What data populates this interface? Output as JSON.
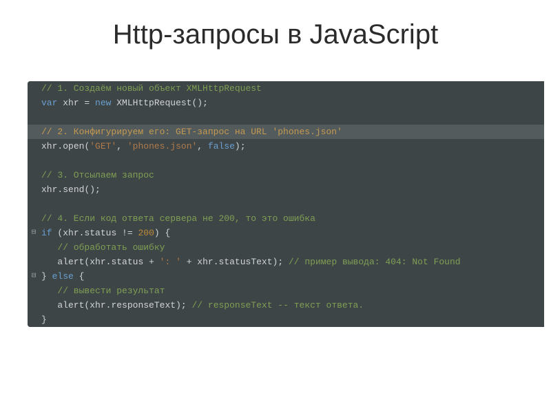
{
  "title": "Http-запросы в JavaScript",
  "code": {
    "lines": [
      {
        "gutter": "",
        "hl": false,
        "tokens": [
          {
            "cls": "c",
            "t": "// 1. Создаём новый объект XMLHttpRequest"
          }
        ]
      },
      {
        "gutter": "",
        "hl": false,
        "tokens": [
          {
            "cls": "kw",
            "t": "var"
          },
          {
            "cls": "pn",
            "t": " "
          },
          {
            "cls": "id",
            "t": "xhr"
          },
          {
            "cls": "pn",
            "t": " = "
          },
          {
            "cls": "kw",
            "t": "new"
          },
          {
            "cls": "pn",
            "t": " "
          },
          {
            "cls": "fn",
            "t": "XMLHttpRequest"
          },
          {
            "cls": "pn",
            "t": "();"
          }
        ]
      },
      {
        "gutter": "",
        "hl": false,
        "tokens": [
          {
            "cls": "pn",
            "t": " "
          }
        ]
      },
      {
        "gutter": "",
        "hl": true,
        "tokens": [
          {
            "cls": "c2",
            "t": "// 2. Конфигурируем его: GET-запрос на URL 'phones.json'"
          }
        ]
      },
      {
        "gutter": "",
        "hl": false,
        "tokens": [
          {
            "cls": "id",
            "t": "xhr"
          },
          {
            "cls": "pn",
            "t": "."
          },
          {
            "cls": "fn",
            "t": "open"
          },
          {
            "cls": "pn",
            "t": "("
          },
          {
            "cls": "st",
            "t": "'GET'"
          },
          {
            "cls": "pn",
            "t": ", "
          },
          {
            "cls": "st",
            "t": "'phones.json'"
          },
          {
            "cls": "pn",
            "t": ", "
          },
          {
            "cls": "kw2",
            "t": "false"
          },
          {
            "cls": "pn",
            "t": ");"
          }
        ]
      },
      {
        "gutter": "",
        "hl": false,
        "tokens": [
          {
            "cls": "pn",
            "t": " "
          }
        ]
      },
      {
        "gutter": "",
        "hl": false,
        "tokens": [
          {
            "cls": "c",
            "t": "// 3. Отсылаем запрос"
          }
        ]
      },
      {
        "gutter": "",
        "hl": false,
        "tokens": [
          {
            "cls": "id",
            "t": "xhr"
          },
          {
            "cls": "pn",
            "t": "."
          },
          {
            "cls": "fn",
            "t": "send"
          },
          {
            "cls": "pn",
            "t": "();"
          }
        ]
      },
      {
        "gutter": "",
        "hl": false,
        "tokens": [
          {
            "cls": "pn",
            "t": " "
          }
        ]
      },
      {
        "gutter": "",
        "hl": false,
        "tokens": [
          {
            "cls": "c",
            "t": "// 4. Если код ответа сервера не 200, то это ошибка"
          }
        ]
      },
      {
        "gutter": "⊟",
        "hl": false,
        "tokens": [
          {
            "cls": "kw",
            "t": "if"
          },
          {
            "cls": "pn",
            "t": " ("
          },
          {
            "cls": "id",
            "t": "xhr"
          },
          {
            "cls": "pn",
            "t": "."
          },
          {
            "cls": "id",
            "t": "status"
          },
          {
            "cls": "pn",
            "t": " != "
          },
          {
            "cls": "nm",
            "t": "200"
          },
          {
            "cls": "pn",
            "t": ") {"
          }
        ]
      },
      {
        "gutter": "",
        "hl": false,
        "tokens": [
          {
            "cls": "pn",
            "t": "   "
          },
          {
            "cls": "c",
            "t": "// обработать ошибку"
          }
        ]
      },
      {
        "gutter": "",
        "hl": false,
        "tokens": [
          {
            "cls": "pn",
            "t": "   "
          },
          {
            "cls": "fn",
            "t": "alert"
          },
          {
            "cls": "pn",
            "t": "("
          },
          {
            "cls": "id",
            "t": "xhr"
          },
          {
            "cls": "pn",
            "t": "."
          },
          {
            "cls": "id",
            "t": "status"
          },
          {
            "cls": "pn",
            "t": " + "
          },
          {
            "cls": "st",
            "t": "': '"
          },
          {
            "cls": "pn",
            "t": " + "
          },
          {
            "cls": "id",
            "t": "xhr"
          },
          {
            "cls": "pn",
            "t": "."
          },
          {
            "cls": "id",
            "t": "statusText"
          },
          {
            "cls": "pn",
            "t": "); "
          },
          {
            "cls": "c",
            "t": "// пример вывода: 404: Not Found"
          }
        ]
      },
      {
        "gutter": "⊟",
        "hl": false,
        "tokens": [
          {
            "cls": "pn",
            "t": "} "
          },
          {
            "cls": "kw",
            "t": "else"
          },
          {
            "cls": "pn",
            "t": " {"
          }
        ]
      },
      {
        "gutter": "",
        "hl": false,
        "tokens": [
          {
            "cls": "pn",
            "t": "   "
          },
          {
            "cls": "c",
            "t": "// вывести результат"
          }
        ]
      },
      {
        "gutter": "",
        "hl": false,
        "tokens": [
          {
            "cls": "pn",
            "t": "   "
          },
          {
            "cls": "fn",
            "t": "alert"
          },
          {
            "cls": "pn",
            "t": "("
          },
          {
            "cls": "id",
            "t": "xhr"
          },
          {
            "cls": "pn",
            "t": "."
          },
          {
            "cls": "id",
            "t": "responseText"
          },
          {
            "cls": "pn",
            "t": "); "
          },
          {
            "cls": "c",
            "t": "// responseText -- текст ответа."
          }
        ]
      },
      {
        "gutter": "",
        "hl": false,
        "tokens": [
          {
            "cls": "pn",
            "t": "}"
          }
        ]
      }
    ]
  }
}
